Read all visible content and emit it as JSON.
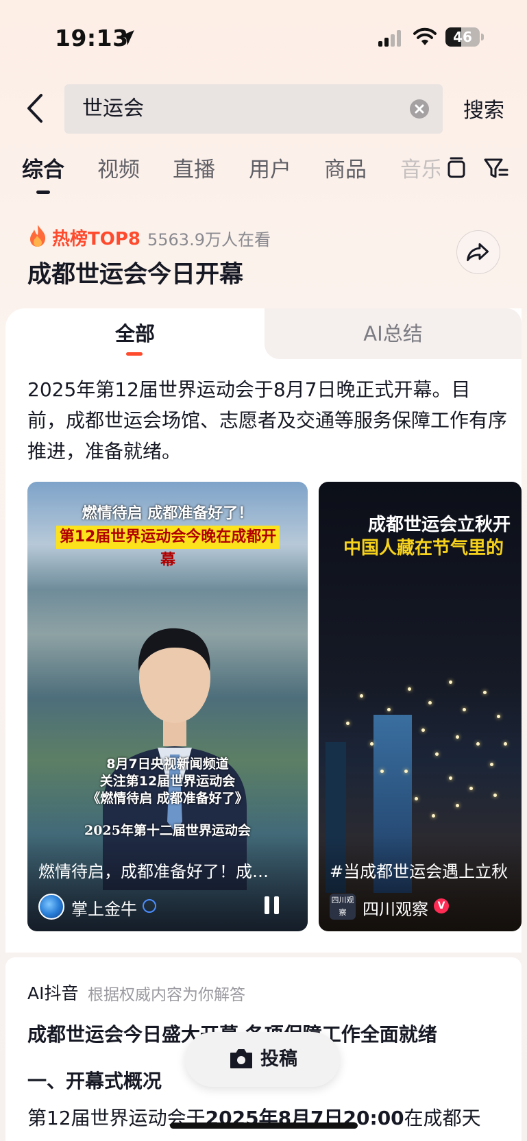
{
  "status_bar": {
    "time": "19:13",
    "battery_level": "46",
    "battery_fraction": 0.46
  },
  "search": {
    "query": "世运会",
    "submit_label": "搜索"
  },
  "category_tabs": [
    {
      "label": "综合",
      "active": true
    },
    {
      "label": "视频",
      "active": false
    },
    {
      "label": "直播",
      "active": false
    },
    {
      "label": "用户",
      "active": false
    },
    {
      "label": "商品",
      "active": false
    },
    {
      "label": "音乐",
      "active": false
    }
  ],
  "hot_topic": {
    "badge": "热榜TOP8",
    "views": "5563.9万人在看",
    "title": "成都世运会今日开幕"
  },
  "content_tabs": {
    "all": "全部",
    "ai_summary": "AI总结"
  },
  "summary_text": "2025年第12届世界运动会于8月7日晚正式开幕。目前，成都世运会场馆、志愿者及交通等服务保障工作有序推进，准备就绪。",
  "videos": [
    {
      "caption_line1": "燃情待启 成都准备好了！",
      "caption_line2": "第12届世界运动会今晚在成都开幕",
      "subtitle_line1": "8月7日央视新闻频道",
      "subtitle_line2": "关注第12届世界运动会",
      "subtitle_line3": "《燃情待启 成都准备好了》",
      "desk_text": "2025年第十二届世界运动会",
      "title": "燃情待启，成都准备好了！成…",
      "author": "掌上金牛"
    },
    {
      "caption_line1": "成都世运会立秋开",
      "caption_line2": "中国人藏在节气里的",
      "title": "#当成都世运会遇上立秋",
      "author": "四川观察",
      "author_logo_text": "四川观察"
    }
  ],
  "ai_answer": {
    "brand": "AI抖音",
    "hint": "根据权威内容为你解答",
    "title": "成都世运会今日盛大开幕 各项保障工作全面就绪",
    "section_heading": "一、开幕式概况",
    "body_prefix": "第12届世界运动会于",
    "body_bold": "2025年8月7日20:00",
    "body_suffix": "在成都天"
  },
  "post_button": {
    "label": "投稿"
  },
  "colors": {
    "accent_red": "#fe4a2d",
    "text_primary": "#161823",
    "caption_yellow": "#fbe21d"
  }
}
